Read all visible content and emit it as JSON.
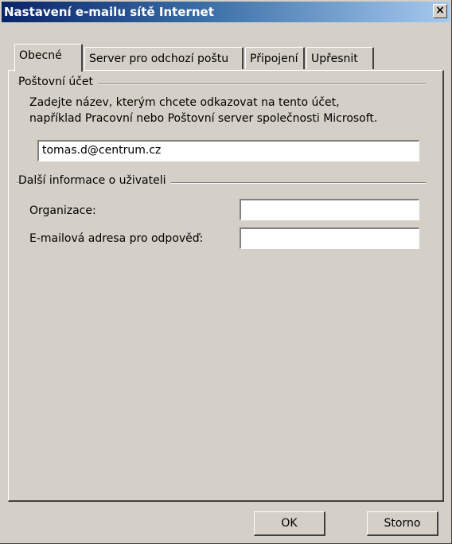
{
  "window": {
    "title": "Nastavení e-mailu sítě Internet",
    "close_glyph": "×"
  },
  "tabs": [
    {
      "label": "Obecné"
    },
    {
      "label": "Server pro odchozí poštu"
    },
    {
      "label": "Připojení"
    },
    {
      "label": "Upřesnit"
    }
  ],
  "account_group": {
    "title": "Poštovní účet",
    "description_line1": "Zadejte název, kterým chcete odkazovat na tento účet,",
    "description_line2": "například Pracovní nebo Poštovní server společnosti Microsoft.",
    "account_name_value": "tomas.d@centrum.cz"
  },
  "user_group": {
    "title": "Další informace o uživateli",
    "organization_label": "Organizace:",
    "organization_value": "",
    "reply_email_label": "E-mailová adresa pro odpověď:",
    "reply_email_value": ""
  },
  "buttons": {
    "ok": "OK",
    "cancel": "Storno"
  }
}
